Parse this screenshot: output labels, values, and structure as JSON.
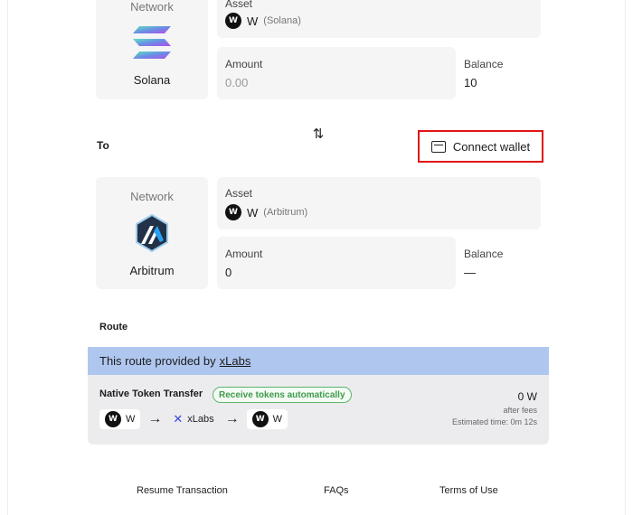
{
  "from": {
    "network_label": "Network",
    "network_name": "Solana",
    "asset_label": "Asset",
    "asset_symbol": "W",
    "asset_chain": "(Solana)",
    "amount_label": "Amount",
    "amount_placeholder": "0.00",
    "balance_label": "Balance",
    "balance_value": "10"
  },
  "to": {
    "section_label": "To",
    "connect_wallet_label": "Connect wallet",
    "network_label": "Network",
    "network_name": "Arbitrum",
    "asset_label": "Asset",
    "asset_symbol": "W",
    "asset_chain": "(Arbitrum)",
    "amount_label": "Amount",
    "amount_value": "0",
    "balance_label": "Balance",
    "balance_value": "—"
  },
  "swap_icon": "swap-vertical-icon",
  "route": {
    "title": "Route",
    "banner_text": "This route provided by",
    "provider_link": "xLabs",
    "name": "Native Token Transfer",
    "badge": "Receive tokens automatically",
    "path_source": "W",
    "path_relayer": "xLabs",
    "path_dest": "W",
    "amount_out": "0 W",
    "after_fees": "after fees",
    "estimated_time": "Estimated time: 0m 12s"
  },
  "footer": {
    "resume": "Resume Transaction",
    "faqs": "FAQs",
    "terms": "Terms of Use"
  },
  "colors": {
    "highlight": "#e01414",
    "banner": "#afc7ef",
    "badge_green": "#3f9a4c"
  }
}
